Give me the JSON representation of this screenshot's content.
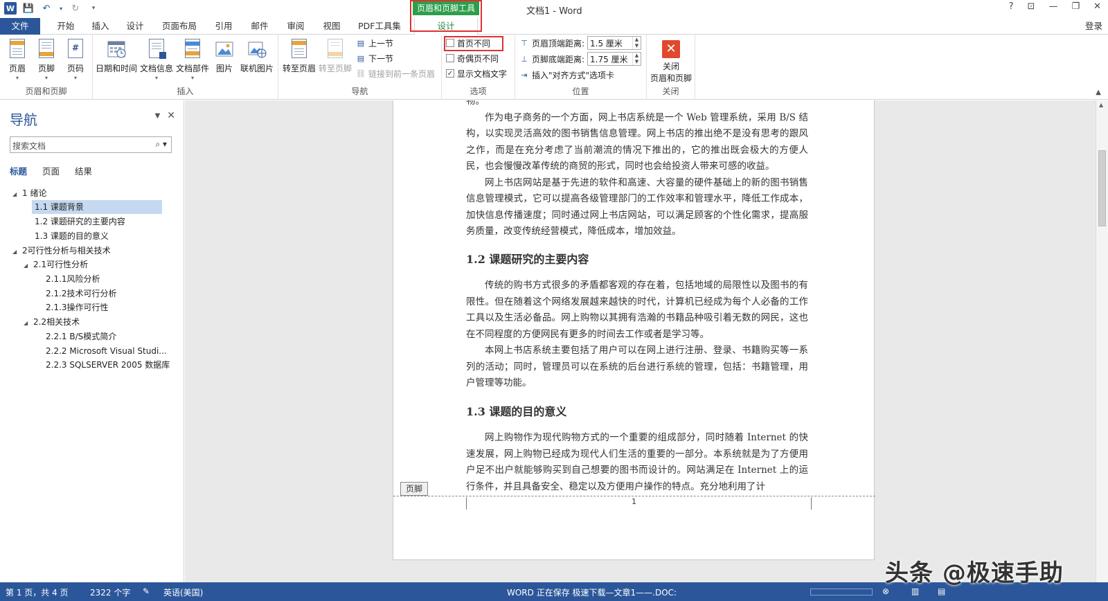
{
  "titlebar": {
    "title": "文档1 - Word",
    "contextual_tab": "页眉和页脚工具",
    "login": "登录"
  },
  "qat": {
    "word_logo": "W",
    "save_icon": "save-icon",
    "undo_icon": "undo-icon",
    "redo_icon": "redo-icon"
  },
  "win": {
    "help": "?",
    "ribbon_options": "⊡",
    "minimize": "—",
    "restore": "❐",
    "close": "✕"
  },
  "tabs": [
    "文件",
    "开始",
    "插入",
    "设计",
    "页面布局",
    "引用",
    "邮件",
    "审阅",
    "视图",
    "PDF工具集",
    "设计"
  ],
  "ribbon": {
    "groups": {
      "header_footer": "页眉和页脚",
      "insert": "插入",
      "navigation": "导航",
      "options": "选项",
      "position": "位置",
      "close": "关闭"
    },
    "header": "页眉",
    "footer": "页脚",
    "page_number": "页码",
    "date_time": "日期和时间",
    "doc_info": "文档信息",
    "doc_parts": "文档部件",
    "picture": "图片",
    "online_picture": "联机图片",
    "goto_header": "转至页眉",
    "goto_footer": "转至页脚",
    "prev_section": "上一节",
    "next_section": "下一节",
    "link_previous": "链接到前一条页眉",
    "first_page_diff": "首页不同",
    "odd_even_diff": "奇偶页不同",
    "show_doc_text": "显示文档文字",
    "header_top_label": "页眉顶端距离:",
    "header_top_value": "1.5 厘米",
    "footer_bottom_label": "页脚底端距离:",
    "footer_bottom_value": "1.75 厘米",
    "insert_align_tab": "插入\"对齐方式\"选项卡",
    "close_line1": "关闭",
    "close_line2": "页眉和页脚"
  },
  "nav": {
    "title": "导航",
    "search_placeholder": "搜索文档",
    "tabs": [
      "标题",
      "页面",
      "结果"
    ],
    "tree": [
      {
        "label": "1   绪论"
      },
      {
        "label": "1.1 课题背景"
      },
      {
        "label": "1.2 课题研究的主要内容"
      },
      {
        "label": "1.3 课题的目的意义"
      },
      {
        "label": "2可行性分析与相关技术"
      },
      {
        "label": "2.1可行性分析"
      },
      {
        "label": "2.1.1风险分析"
      },
      {
        "label": "2.1.2技术可行分析"
      },
      {
        "label": "2.1.3操作可行性"
      },
      {
        "label": "2.2相关技术"
      },
      {
        "label": "2.2.1 B/S模式简介"
      },
      {
        "label": "2.2.2 Microsoft Visual Studi..."
      },
      {
        "label": "2.2.3 SQLSERVER 2005 数据库"
      }
    ]
  },
  "doc": {
    "p0": "物。",
    "p1": "作为电子商务的一个方面，网上书店系统是一个 Web 管理系统，采用 B/S 结构，以实现灵活高效的图书销售信息管理。网上书店的推出绝不是没有思考的跟风之作，而是在充分考虑了当前潮流的情况下推出的，它的推出既会极大的方便人民，也会慢慢改革传统的商贸的形式，同时也会给投资人带来可感的收益。",
    "p2": "网上书店网站是基于先进的软件和高速、大容量的硬件基础上的新的图书销售信息管理模式，它可以提高各级管理部门的工作效率和管理水平，降低工作成本，加快信息传播速度；同时通过网上书店网站，可以满足顾客的个性化需求，提高服务质量，改变传统经营模式，降低成本，增加效益。",
    "h12": "1.2  课题研究的主要内容",
    "p3": "传统的购书方式很多的矛盾都客观的存在着，包括地域的局限性以及图书的有限性。但在随着这个网络发展越来越快的时代，计算机已经成为每个人必备的工作工具以及生活必备品。网上购物以其拥有浩瀚的书籍品种吸引着无数的网民，这也在不同程度的方便网民有更多的时间去工作或者是学习等。",
    "p4": "本网上书店系统主要包括了用户可以在网上进行注册、登录、书籍购买等一系列的活动；同时，管理员可以在系统的后台进行系统的管理，包括：书籍管理，用户管理等功能。",
    "h13": "1.3  课题的目的意义",
    "p5": "网上购物作为现代购物方式的一个重要的组成部分，同时随着 Internet 的快速发展，网上购物已经成为现代人们生活的重要的一部分。本系统就是为了方便用户足不出户就能够购买到自己想要的图书而设计的。网站满足在 Internet 上的运行条件，并且具备安全、稳定以及方便用户操作的特点。充分地利用了计",
    "footer_tag": "页脚",
    "page_number": "1"
  },
  "status": {
    "page": "第 1 页，共 4 页",
    "words": "2322 个字",
    "lang": "英语(美国)",
    "saving": "WORD 正在保存 极速下载—文章1——.DOC:"
  },
  "watermark": "头条 @极速手助"
}
